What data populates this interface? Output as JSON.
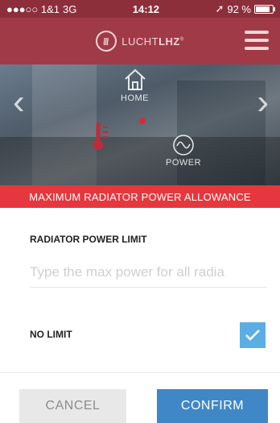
{
  "status_bar": {
    "carrier": "●●●○○ 1&1",
    "network": "3G",
    "time": "14:12",
    "battery_text": "92 %",
    "battery_level": 0.92
  },
  "header": {
    "logo_text_light": "LUCHT",
    "logo_text_bold": "LHZ",
    "logo_sup": "®",
    "menu_icon": "hamburger-menu-icon",
    "color": "#a13a47"
  },
  "hero": {
    "home_label": "HOME",
    "power_label": "POWER"
  },
  "banner": {
    "title": "MAXIMUM RADIATOR POWER ALLOWANCE",
    "color": "#e5373d"
  },
  "form": {
    "power_limit_label": "RADIATOR POWER LIMIT",
    "power_input_placeholder": "Type the max power for all radia",
    "power_input_value": "",
    "no_limit_label": "NO LIMIT",
    "no_limit_checked": true,
    "checkbox_color": "#5aaee3"
  },
  "buttons": {
    "cancel_label": "CANCEL",
    "confirm_label": "CONFIRM",
    "confirm_color": "#3f87c7"
  }
}
